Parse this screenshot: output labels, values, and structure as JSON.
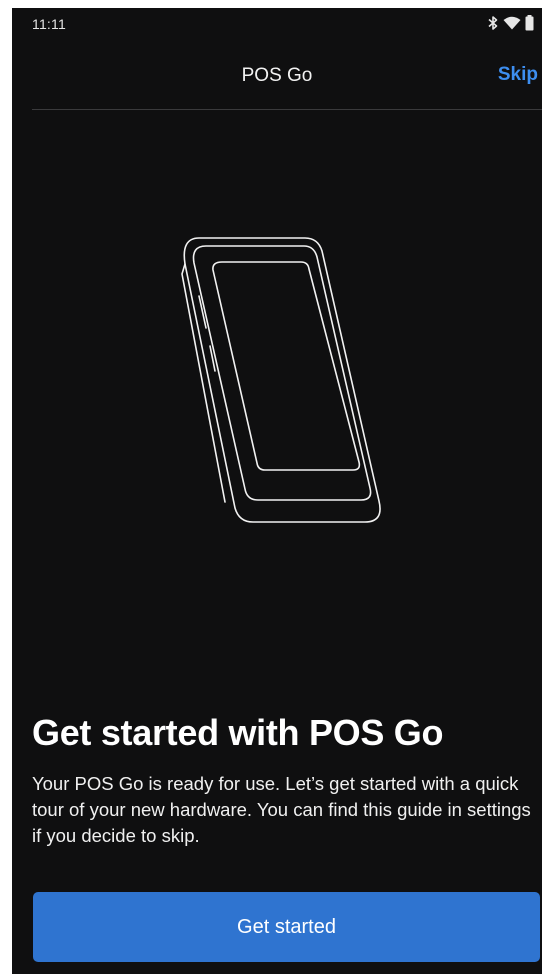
{
  "status_bar": {
    "time": "11:11",
    "icons": [
      "bluetooth-icon",
      "wifi-icon",
      "battery-icon"
    ]
  },
  "header": {
    "title": "POS Go",
    "skip_label": "Skip"
  },
  "illustration": {
    "icon": "pos-device-outline"
  },
  "onboarding": {
    "headline": "Get started with POS Go",
    "body": "Your POS Go is ready for use. Let’s get started with a quick tour of your new hardware. You can find this guide in settings if you decide to skip.",
    "primary_button_label": "Get started"
  },
  "colors": {
    "background": "#0f0f10",
    "accent_link": "#3d8ef0",
    "primary_button": "#2f74d0",
    "text": "#ffffff"
  }
}
